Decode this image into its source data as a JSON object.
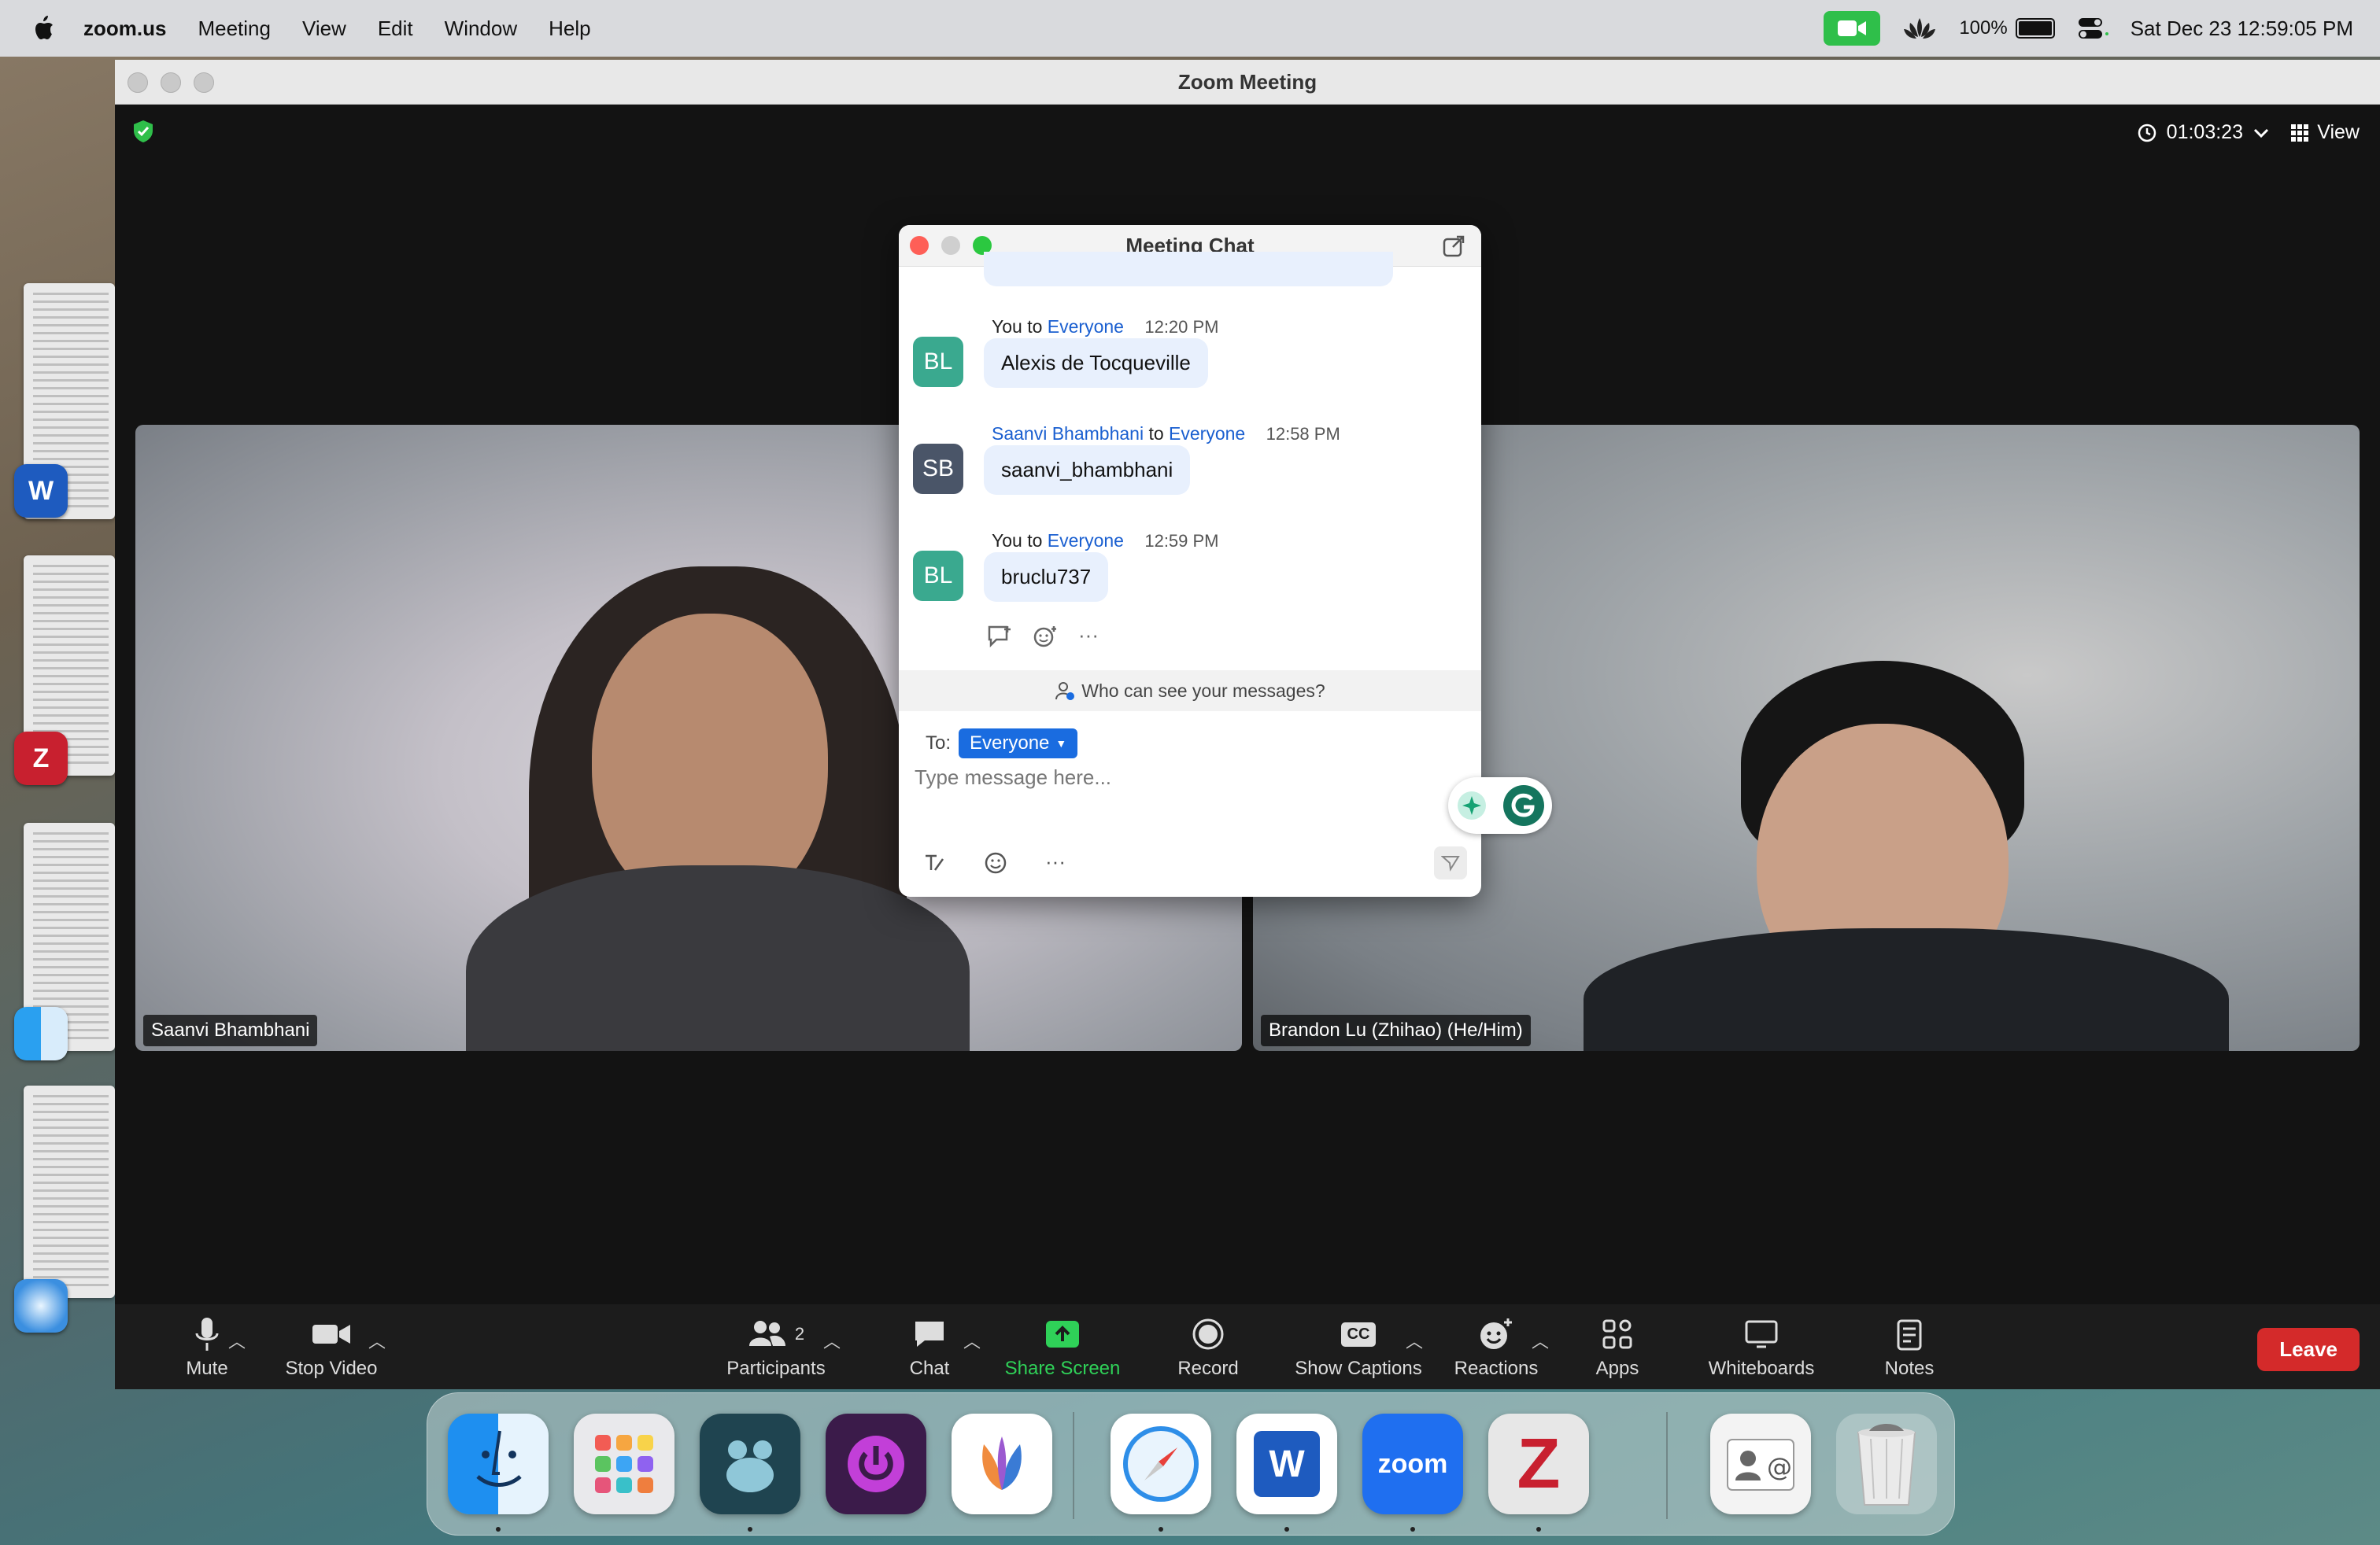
{
  "menubar": {
    "app_name": "zoom.us",
    "menus": [
      "Meeting",
      "View",
      "Edit",
      "Window",
      "Help"
    ],
    "battery": "100%",
    "battery_level": 1.0,
    "clock": "Sat Dec 23  12:59:05 PM"
  },
  "window": {
    "title": "Zoom Meeting",
    "timer": "01:03:23",
    "view_label": "View"
  },
  "participants": [
    {
      "name": "Saanvi Bhambhani"
    },
    {
      "name": "Brandon Lu (Zhihao) (He/Him)"
    }
  ],
  "chat": {
    "title": "Meeting Chat",
    "messages": [
      {
        "initials": "BL",
        "sender": "You",
        "to_word": "to",
        "recipient": "Everyone",
        "time": "12:20 PM",
        "text": "Alexis de Tocqueville",
        "avatar_color": "#3aa98f"
      },
      {
        "initials": "SB",
        "sender": "Saanvi Bhambhani",
        "to_word": "to",
        "recipient": "Everyone",
        "time": "12:58 PM",
        "text": "saanvi_bhambhani",
        "avatar_color": "#4a5568"
      },
      {
        "initials": "BL",
        "sender": "You",
        "to_word": "to",
        "recipient": "Everyone",
        "time": "12:59 PM",
        "text": "bruclu737",
        "avatar_color": "#3aa98f"
      }
    ],
    "privacy_text": "Who can see your messages?",
    "to_label": "To:",
    "to_value": "Everyone",
    "input_placeholder": "Type message here..."
  },
  "toolbar": {
    "mute": "Mute",
    "stop_video": "Stop Video",
    "participants": "Participants",
    "participant_count": "2",
    "chat": "Chat",
    "share_screen": "Share Screen",
    "record": "Record",
    "cc_badge": "CC",
    "show_captions": "Show Captions",
    "reactions": "Reactions",
    "apps": "Apps",
    "whiteboards": "Whiteboards",
    "notes": "Notes",
    "leave": "Leave"
  },
  "dock": {
    "zoom_label": "zoom",
    "word_letter": "W"
  },
  "colors": {
    "share_green": "#2fd158",
    "leave_red": "#d42a2a",
    "chat_blue": "#1a6ce0"
  }
}
